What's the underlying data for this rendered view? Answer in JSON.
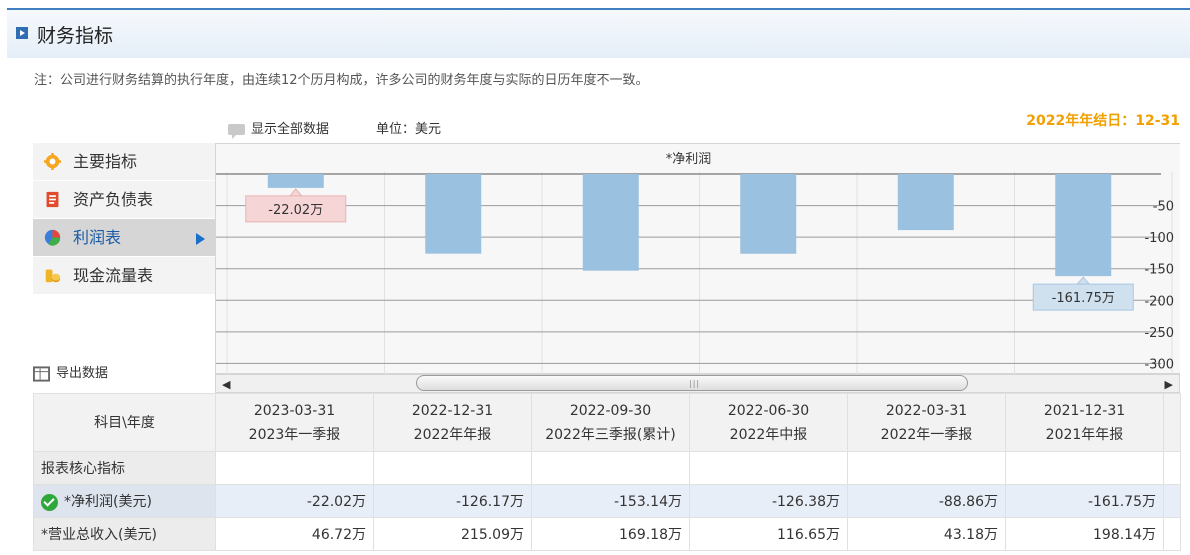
{
  "header": {
    "title": "财务指标"
  },
  "note": "注：公司进行财务结算的执行年度，由连续12个历月构成，许多公司的财务年度与实际的日历年度不一致。",
  "year_end": "2022年年结日：12-31",
  "toolbar": {
    "show_all": "显示全部数据",
    "unit": "单位：美元"
  },
  "sidenav": {
    "items": [
      {
        "label": "主要指标",
        "icon": "gear-icon"
      },
      {
        "label": "资产负债表",
        "icon": "document-icon"
      },
      {
        "label": "利润表",
        "icon": "pie-chart-icon",
        "active": true
      },
      {
        "label": "现金流量表",
        "icon": "coins-icon"
      }
    ]
  },
  "export_label": "导出数据",
  "colors": {
    "bar": "#9ac1df",
    "accent": "#f0a000",
    "nav_active_text": "#1a5aa5"
  },
  "chart_data": {
    "type": "bar",
    "title": "*净利润",
    "categories": [
      "2023-03-31",
      "2022-12-31",
      "2022-09-30",
      "2022-06-30",
      "2022-03-31",
      "2021-12-31"
    ],
    "values": [
      -22.02,
      -126.17,
      -153.14,
      -126.38,
      -88.86,
      -161.75
    ],
    "ylim": [
      -320,
      0
    ],
    "yticks": [
      -50,
      -100,
      -150,
      -200,
      -250,
      -300
    ],
    "ytick_labels": [
      "-50",
      "-100",
      "-150",
      "-200",
      "-250",
      "-300"
    ],
    "annotations": [
      {
        "index": 0,
        "text": "-22.02万"
      },
      {
        "index": 5,
        "text": "-161.75万"
      }
    ]
  },
  "table": {
    "corner": "科目\\年度",
    "columns": [
      {
        "date": "2023-03-31",
        "period": "2023年一季报"
      },
      {
        "date": "2022-12-31",
        "period": "2022年年报"
      },
      {
        "date": "2022-09-30",
        "period": "2022年三季报(累计)"
      },
      {
        "date": "2022-06-30",
        "period": "2022年中报"
      },
      {
        "date": "2022-03-31",
        "period": "2022年一季报"
      },
      {
        "date": "2021-12-31",
        "period": "2021年年报"
      }
    ],
    "section": "报表核心指标",
    "rows": [
      {
        "label": "*净利润(美元)",
        "values": [
          "-22.02万",
          "-126.17万",
          "-153.14万",
          "-126.38万",
          "-88.86万",
          "-161.75万"
        ]
      },
      {
        "label": "*营业总收入(美元)",
        "values": [
          "46.72万",
          "215.09万",
          "169.18万",
          "116.65万",
          "43.18万",
          "198.14万"
        ]
      }
    ]
  }
}
